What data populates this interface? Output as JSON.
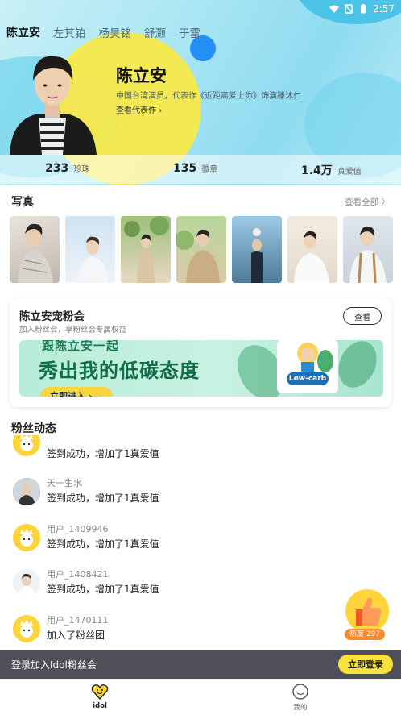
{
  "status_bar": {
    "time": "2:57"
  },
  "tabs": [
    {
      "label": "陈立安",
      "active": true
    },
    {
      "label": "左其铂",
      "active": false
    },
    {
      "label": "杨昊铭",
      "active": false
    },
    {
      "label": "舒灏",
      "active": false
    },
    {
      "label": "于雷",
      "active": false
    }
  ],
  "star": {
    "name": "陈立安",
    "description": "中国台湾演员，代表作《近距离爱上你》饰演滕沐仁",
    "works_link": "查看代表作 ›"
  },
  "stats": [
    {
      "value": "233",
      "label": "珍珠"
    },
    {
      "value": "135",
      "label": "徽章"
    },
    {
      "value": "1.4万",
      "label": "真爱值"
    }
  ],
  "photos_section": {
    "title": "写真",
    "see_all": "查看全部 〉"
  },
  "fan_club": {
    "title": "陈立安宠粉会",
    "subtitle": "加入粉丝会，享粉丝会专属权益",
    "view_button": "查看",
    "banner": {
      "top_line": "跟陈立安一起",
      "main_line": "秀出我的低碳态度",
      "button": "立即进入 ›",
      "badge": "Low-carb"
    }
  },
  "feed": {
    "title": "粉丝动态",
    "items": [
      {
        "user": "",
        "text": "签到成功，增加了1真爱值",
        "avatar": "yellow-mascot"
      },
      {
        "user": "天一生水",
        "text": "签到成功，增加了1真爱值",
        "avatar": "photo-dark"
      },
      {
        "user": "用户_1409946",
        "text": "签到成功，增加了1真爱值",
        "avatar": "yellow-mascot"
      },
      {
        "user": "用户_1408421",
        "text": "签到成功，增加了1真爱值",
        "avatar": "photo-light"
      },
      {
        "user": "用户_1470111",
        "text": "加入了粉丝团",
        "avatar": "yellow-mascot"
      }
    ]
  },
  "hot": {
    "label": "热度 297"
  },
  "login_bar": {
    "text": "登录加入Idol粉丝会",
    "button": "立即登录"
  },
  "bottom_nav": [
    {
      "label": "idol",
      "active": true
    },
    {
      "label": "我的",
      "active": false
    }
  ],
  "colors": {
    "accent_yellow": "#f7e94a",
    "hero_cyan": "#8fdbf0",
    "accent_blue": "#2490f5"
  }
}
